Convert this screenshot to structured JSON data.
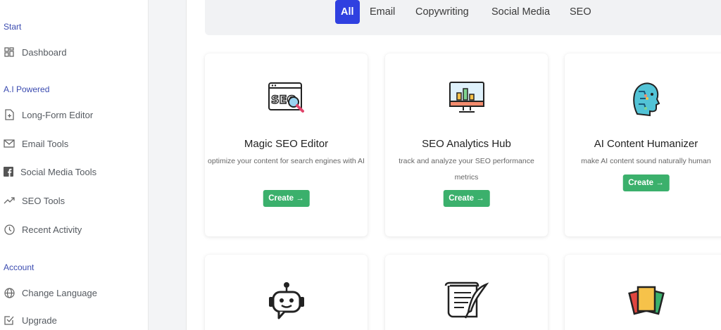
{
  "sidebar": {
    "sections": {
      "start": "Start",
      "ai": "A.I Powered",
      "account": "Account"
    },
    "items": {
      "dashboard": "Dashboard",
      "long_form": "Long-Form Editor",
      "email": "Email Tools",
      "social": "Social Media Tools",
      "seo": "SEO Tools",
      "recent": "Recent Activity",
      "language": "Change Language",
      "upgrade": "Upgrade"
    }
  },
  "tabs": [
    "All",
    "Email",
    "Copywriting",
    "Social Media",
    "SEO"
  ],
  "cards": [
    {
      "title": "Magic SEO Editor",
      "desc": "optimize your content for search engines with AI",
      "button": "Create →",
      "icon": "seo-magnifier-icon"
    },
    {
      "title": "SEO Analytics Hub",
      "desc": "track and analyze your SEO performance metrics",
      "button": "Create →",
      "icon": "analytics-monitor-icon"
    },
    {
      "title": "AI Content Humanizer",
      "desc": "make AI content sound naturally human",
      "button": "Create →",
      "icon": "ai-head-icon"
    }
  ],
  "colors": {
    "accent": "#2f40e0",
    "button": "#3bb06c",
    "section": "#3b4bb0"
  }
}
